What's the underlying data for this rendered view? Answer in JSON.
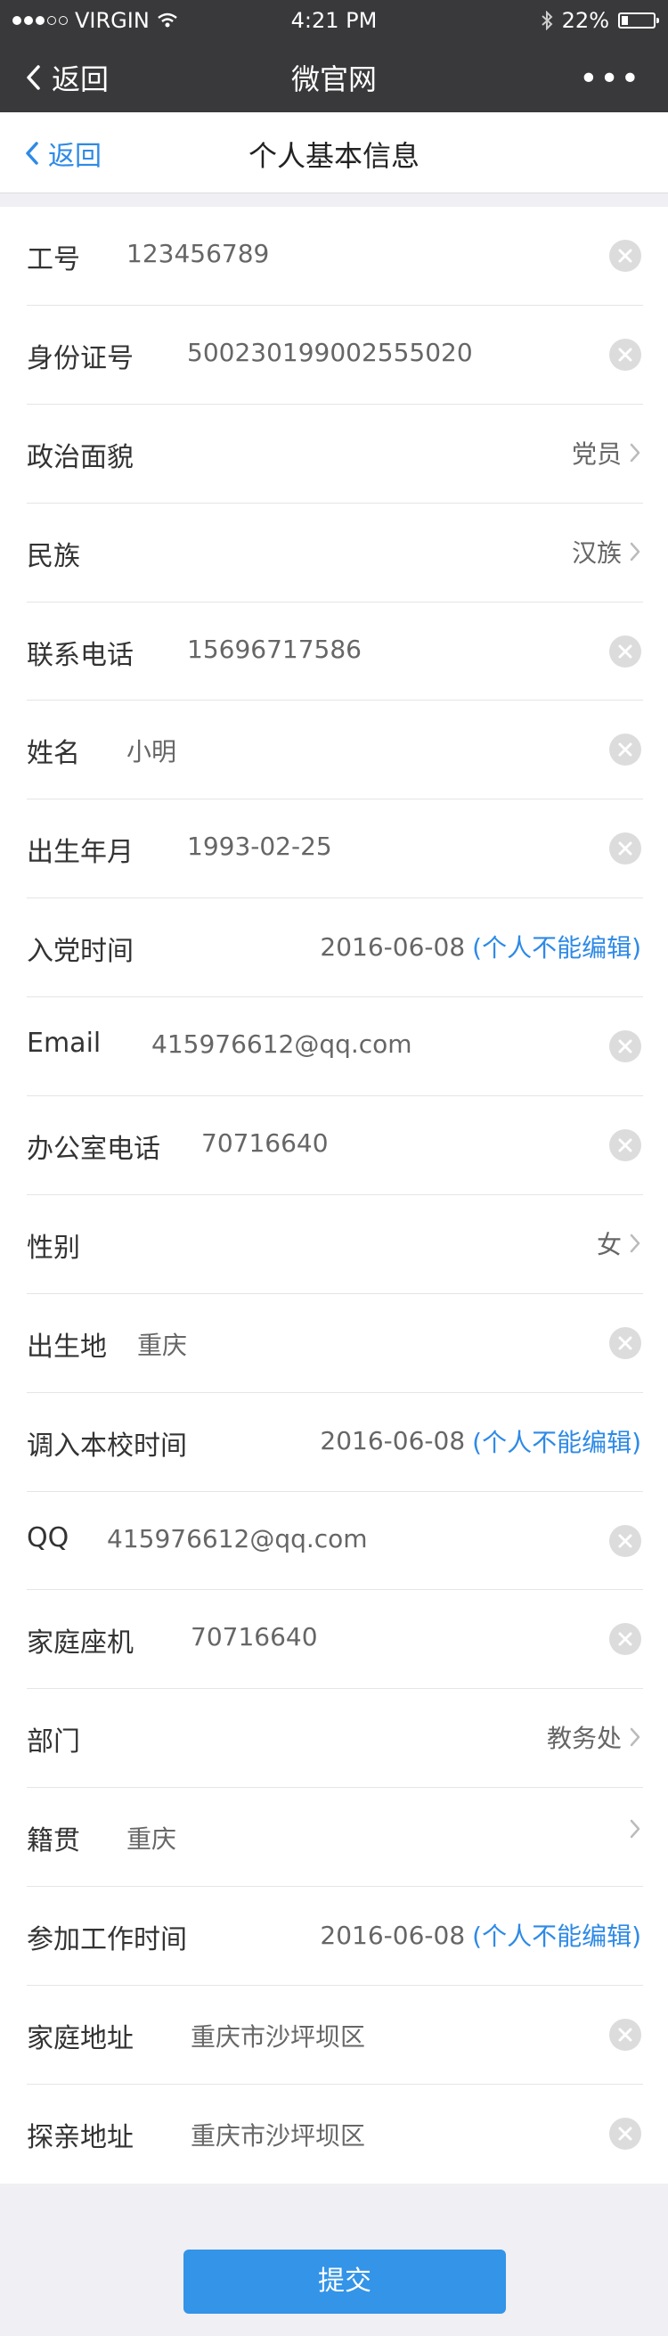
{
  "status": {
    "carrier": "VIRGIN",
    "time": "4:21 PM",
    "battery": "22%",
    "battery_level": 0.22
  },
  "nav": {
    "back": "返回",
    "title": "微官网",
    "more": "•••"
  },
  "header": {
    "back": "返回",
    "title": "个人基本信息"
  },
  "fields": [
    {
      "label": "工号",
      "value": "123456789",
      "kind": "input"
    },
    {
      "label": "身份证号",
      "value": "500230199002555020",
      "kind": "input"
    },
    {
      "label": "政治面貌",
      "value": "党员",
      "kind": "select"
    },
    {
      "label": "民族",
      "value": "汉族",
      "kind": "select"
    },
    {
      "label": "联系电话",
      "value": "15696717586",
      "kind": "input"
    },
    {
      "label": "姓名",
      "value": "小明",
      "kind": "input"
    },
    {
      "label": "出生年月",
      "value": "1993-02-25",
      "kind": "input"
    },
    {
      "label": "入党时间",
      "value": "2016-06-08",
      "note": "(个人不能编辑)",
      "kind": "readonly"
    },
    {
      "label": "Email",
      "value": "415976612@qq.com",
      "kind": "input"
    },
    {
      "label": "办公室电话",
      "value": "70716640",
      "kind": "input"
    },
    {
      "label": "性别",
      "value": "女",
      "kind": "select"
    },
    {
      "label": "出生地",
      "value": "重庆",
      "kind": "input"
    },
    {
      "label": "调入本校时间",
      "value": "2016-06-08",
      "note": "(个人不能编辑)",
      "kind": "readonly"
    },
    {
      "label": "QQ",
      "value": "415976612@qq.com",
      "kind": "input"
    },
    {
      "label": "家庭座机",
      "value": "70716640",
      "kind": "input"
    },
    {
      "label": "部门",
      "value": "教务处",
      "kind": "select"
    },
    {
      "label": "籍贯",
      "value": "重庆",
      "kind": "select-left"
    },
    {
      "label": "参加工作时间",
      "value": "2016-06-08",
      "note": "(个人不能编辑)",
      "kind": "readonly"
    },
    {
      "label": "家庭地址",
      "value": "重庆市沙坪坝区",
      "kind": "input"
    },
    {
      "label": "探亲地址",
      "value": "重庆市沙坪坝区",
      "kind": "input"
    }
  ],
  "submit_label": "提交"
}
